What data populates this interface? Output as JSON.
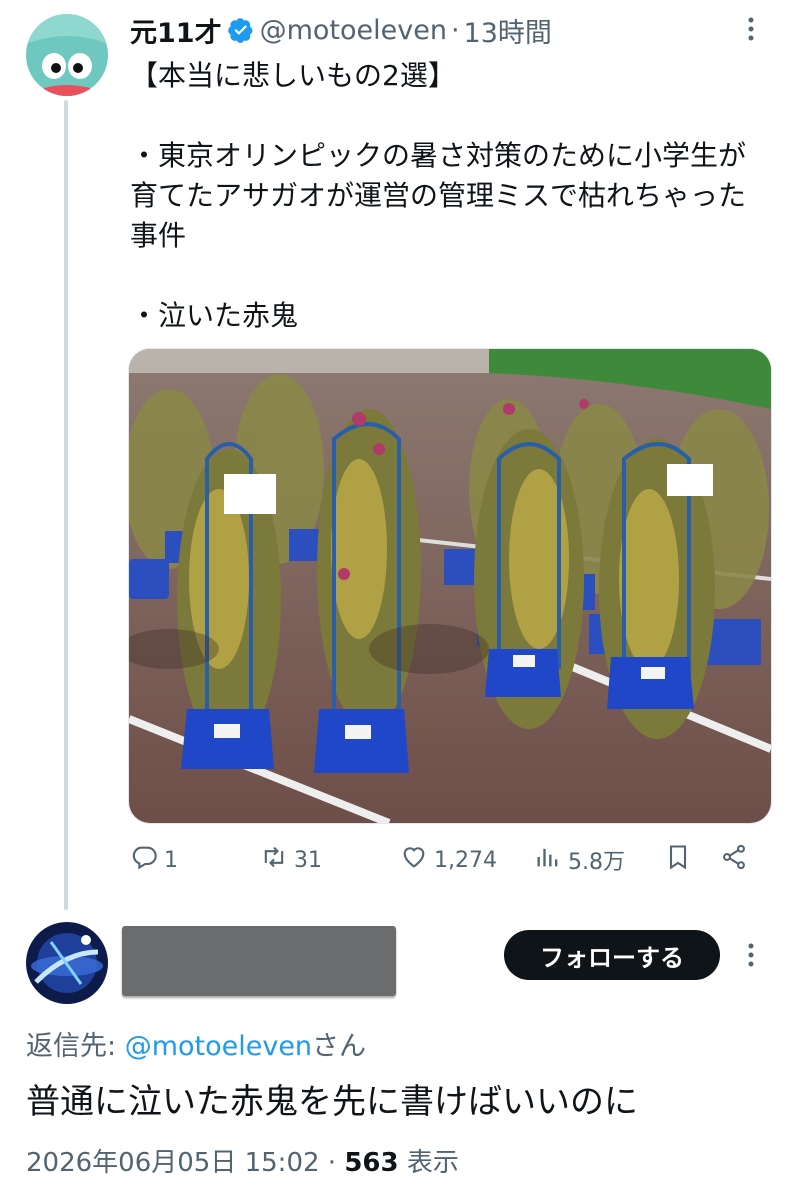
{
  "tweet": {
    "display_name": "元11才",
    "handle": "@motoeleven",
    "separator": "·",
    "time": "13時間",
    "text": "【本当に悲しいもの2選】\n\n・東京オリンピックの暑さ対策のために小学生が育てたアサガオが運営の管理ミスで枯れちゃった事件\n\n・泣いた赤鬼",
    "actions": {
      "replies": "1",
      "retweets": "31",
      "likes": "1,274",
      "views": "5.8万"
    },
    "media_image_sign_1": "[名前札]",
    "media_image_sign_2": "[名前札]"
  },
  "reply": {
    "follow_label": "フォローする",
    "replying_prefix": "返信先: ",
    "replying_mention": "@motoeleven",
    "replying_suffix": "さん",
    "text": "普通に泣いた赤鬼を先に書けばいいのに",
    "date": "2026年06月05日 15:02",
    "dot": " · ",
    "views_count": "563",
    "views_label": " 表示"
  },
  "colors": {
    "accent": "#1d9bf0",
    "secondary_text": "#536471",
    "follow_button_bg": "#0f1419"
  },
  "icons": [
    "verified-badge-icon",
    "more-icon",
    "reply-icon",
    "retweet-icon",
    "like-icon",
    "views-icon",
    "bookmark-icon",
    "share-icon"
  ]
}
